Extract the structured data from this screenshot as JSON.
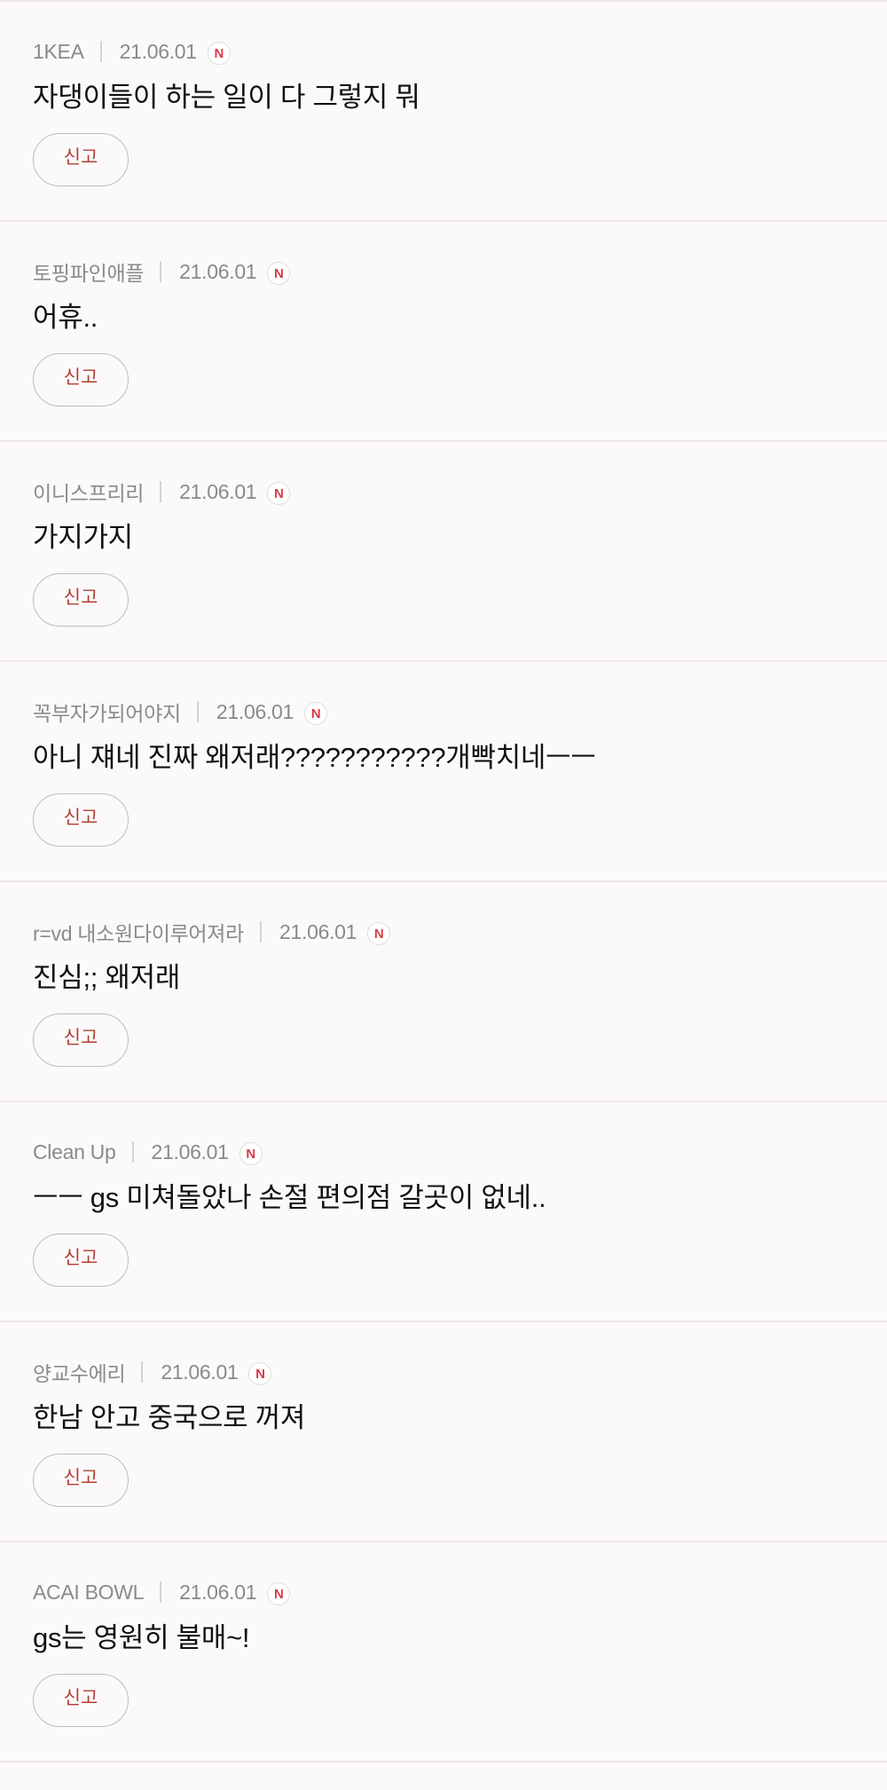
{
  "comments": [
    {
      "author": "1KEA",
      "date": "21.06.01",
      "badge": "N",
      "text": "자댕이들이 하는 일이 다 그렇지 뭐",
      "report_label": "신고"
    },
    {
      "author": "토핑파인애플",
      "date": "21.06.01",
      "badge": "N",
      "text": "어휴..",
      "report_label": "신고"
    },
    {
      "author": "이니스프리리",
      "date": "21.06.01",
      "badge": "N",
      "text": "가지가지",
      "report_label": "신고"
    },
    {
      "author": "꼭부자가되어야지",
      "date": "21.06.01",
      "badge": "N",
      "text": "아니 쟤네 진짜 왜저래???????????개빡치네ㅡㅡ",
      "report_label": "신고"
    },
    {
      "author": "r=vd 내소원다이루어져라",
      "date": "21.06.01",
      "badge": "N",
      "text": "진심;; 왜저래",
      "report_label": "신고"
    },
    {
      "author": "Clean Up",
      "date": "21.06.01",
      "badge": "N",
      "text": "ㅡㅡ gs 미쳐돌았나 손절 편의점 갈곳이 없네..",
      "report_label": "신고"
    },
    {
      "author": "양교수에리",
      "date": "21.06.01",
      "badge": "N",
      "text": "한남 안고 중국으로 꺼져",
      "report_label": "신고"
    },
    {
      "author": "ACAI BOWL",
      "date": "21.06.01",
      "badge": "N",
      "text": "gs는 영원히 불매~!",
      "report_label": "신고"
    }
  ],
  "colors": {
    "background": "#fcf9fb",
    "divider": "#ece7ea",
    "meta_text": "#8a8a8a",
    "report_text": "#b04032",
    "badge": "#d93a4a"
  }
}
